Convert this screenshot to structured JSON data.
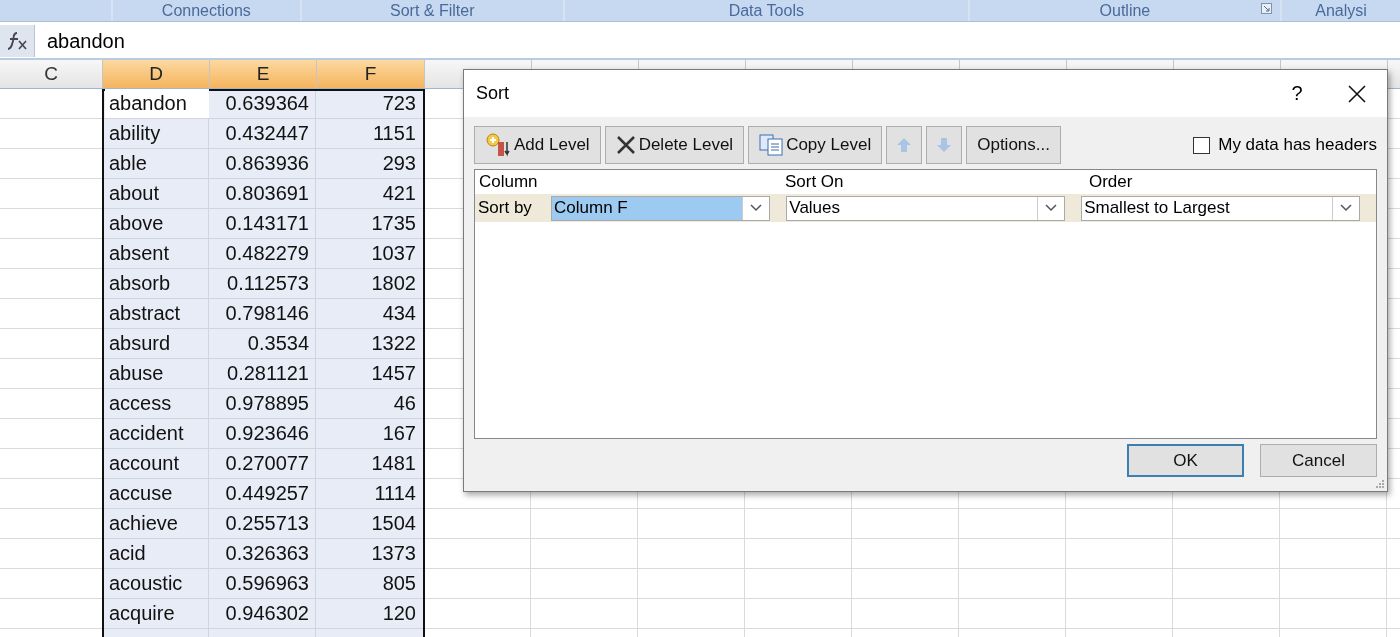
{
  "ribbon_groups": [
    {
      "label": "Connections",
      "launcher": false
    },
    {
      "label": "Sort & Filter",
      "launcher": false
    },
    {
      "label": "Data Tools",
      "launcher": false
    },
    {
      "label": "Outline",
      "launcher": true
    },
    {
      "label": "Analysi",
      "launcher": false
    }
  ],
  "formula_bar": {
    "value": "abandon"
  },
  "columns": [
    {
      "label": "C",
      "selected": false
    },
    {
      "label": "D",
      "selected": true
    },
    {
      "label": "E",
      "selected": true
    },
    {
      "label": "F",
      "selected": true
    }
  ],
  "rows": [
    {
      "cells": [
        "abandon",
        "0.639364",
        "723"
      ],
      "active": true
    },
    {
      "cells": [
        "ability",
        "0.432447",
        "1151"
      ],
      "active": false
    },
    {
      "cells": [
        "able",
        "0.863936",
        "293"
      ],
      "active": false
    },
    {
      "cells": [
        "about",
        "0.803691",
        "421"
      ],
      "active": false
    },
    {
      "cells": [
        "above",
        "0.143171",
        "1735"
      ],
      "active": false
    },
    {
      "cells": [
        "absent",
        "0.482279",
        "1037"
      ],
      "active": false
    },
    {
      "cells": [
        "absorb",
        "0.112573",
        "1802"
      ],
      "active": false
    },
    {
      "cells": [
        "abstract",
        "0.798146",
        "434"
      ],
      "active": false
    },
    {
      "cells": [
        "absurd",
        "0.3534",
        "1322"
      ],
      "active": false
    },
    {
      "cells": [
        "abuse",
        "0.281121",
        "1457"
      ],
      "active": false
    },
    {
      "cells": [
        "access",
        "0.978895",
        "46"
      ],
      "active": false
    },
    {
      "cells": [
        "accident",
        "0.923646",
        "167"
      ],
      "active": false
    },
    {
      "cells": [
        "account",
        "0.270077",
        "1481"
      ],
      "active": false
    },
    {
      "cells": [
        "accuse",
        "0.449257",
        "1114"
      ],
      "active": false
    },
    {
      "cells": [
        "achieve",
        "0.255713",
        "1504"
      ],
      "active": false
    },
    {
      "cells": [
        "acid",
        "0.326363",
        "1373"
      ],
      "active": false
    },
    {
      "cells": [
        "acoustic",
        "0.596963",
        "805"
      ],
      "active": false
    },
    {
      "cells": [
        "acquire",
        "0.946302",
        "120"
      ],
      "active": false
    }
  ],
  "dialog": {
    "title": "Sort",
    "help": "?",
    "toolbar": [
      {
        "kind": "add",
        "label": "Add Level",
        "disabled": false
      },
      {
        "kind": "delete",
        "label": "Delete Level",
        "disabled": false
      },
      {
        "kind": "copy",
        "label": "Copy Level",
        "disabled": false
      },
      {
        "kind": "up",
        "disabled": true
      },
      {
        "kind": "down",
        "disabled": true
      },
      {
        "kind": "options",
        "label": "Options...",
        "disabled": false
      }
    ],
    "headers_checkbox": {
      "label": "My data has headers",
      "checked": false
    },
    "level_headers": [
      "Column",
      "Sort On",
      "Order"
    ],
    "levels": [
      {
        "label": "Sort by",
        "column": "Column F",
        "sort_on": "Values",
        "order": "Smallest to Largest",
        "selected": true
      }
    ],
    "buttons": [
      {
        "label": "OK",
        "default": true
      },
      {
        "label": "Cancel",
        "default": false
      }
    ]
  }
}
